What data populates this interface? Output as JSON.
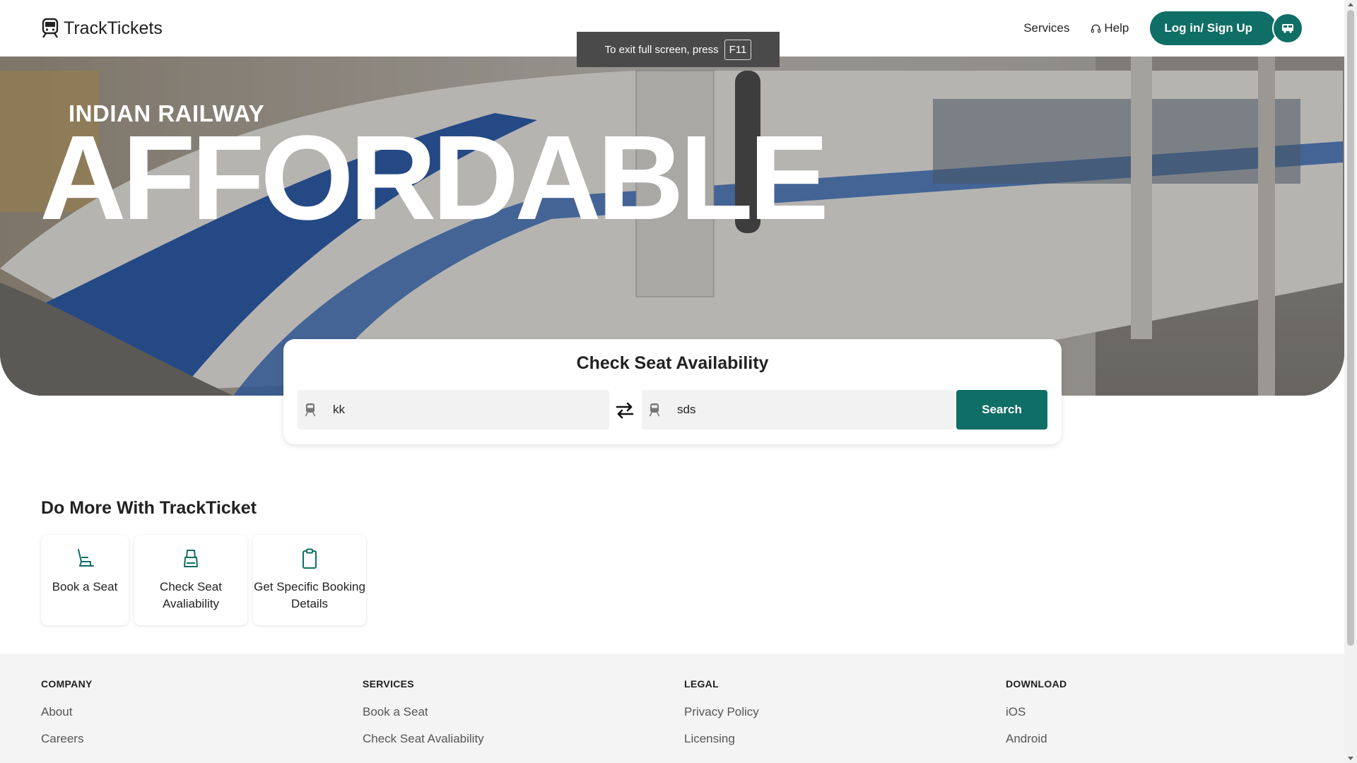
{
  "header": {
    "brand": "TrackTickets",
    "brand_icon": "train-icon",
    "nav": {
      "services": "Services",
      "help": "Help"
    },
    "login_label": "Log in/ Sign Up"
  },
  "fullscreen_toast": {
    "text": "To exit full screen, press",
    "key": "F11"
  },
  "hero": {
    "subtitle": "INDIAN RAILWAY",
    "title": "AFFORDABLE"
  },
  "search": {
    "title": "Check Seat Availability",
    "from_value": "kk",
    "to_value": "sds",
    "button": "Search"
  },
  "more": {
    "title": "Do More With TrackTicket",
    "tiles": [
      {
        "label": "Book a Seat",
        "icon": "seat-icon"
      },
      {
        "label": "Check Seat Avaliability",
        "icon": "car-seat-icon"
      },
      {
        "label": "Get Specific Booking Details",
        "icon": "clipboard-icon"
      }
    ]
  },
  "footer": {
    "columns": [
      {
        "heading": "COMPANY",
        "links": [
          "About",
          "Careers"
        ]
      },
      {
        "heading": "SERVICES",
        "links": [
          "Book a Seat",
          "Check Seat Avaliability"
        ]
      },
      {
        "heading": "LEGAL",
        "links": [
          "Privacy Policy",
          "Licensing"
        ]
      },
      {
        "heading": "DOWNLOAD",
        "links": [
          "iOS",
          "Android"
        ]
      }
    ]
  },
  "colors": {
    "accent": "#0f6e65",
    "footer_bg": "#f3f4f3",
    "field_bg": "#f1f2f1"
  }
}
